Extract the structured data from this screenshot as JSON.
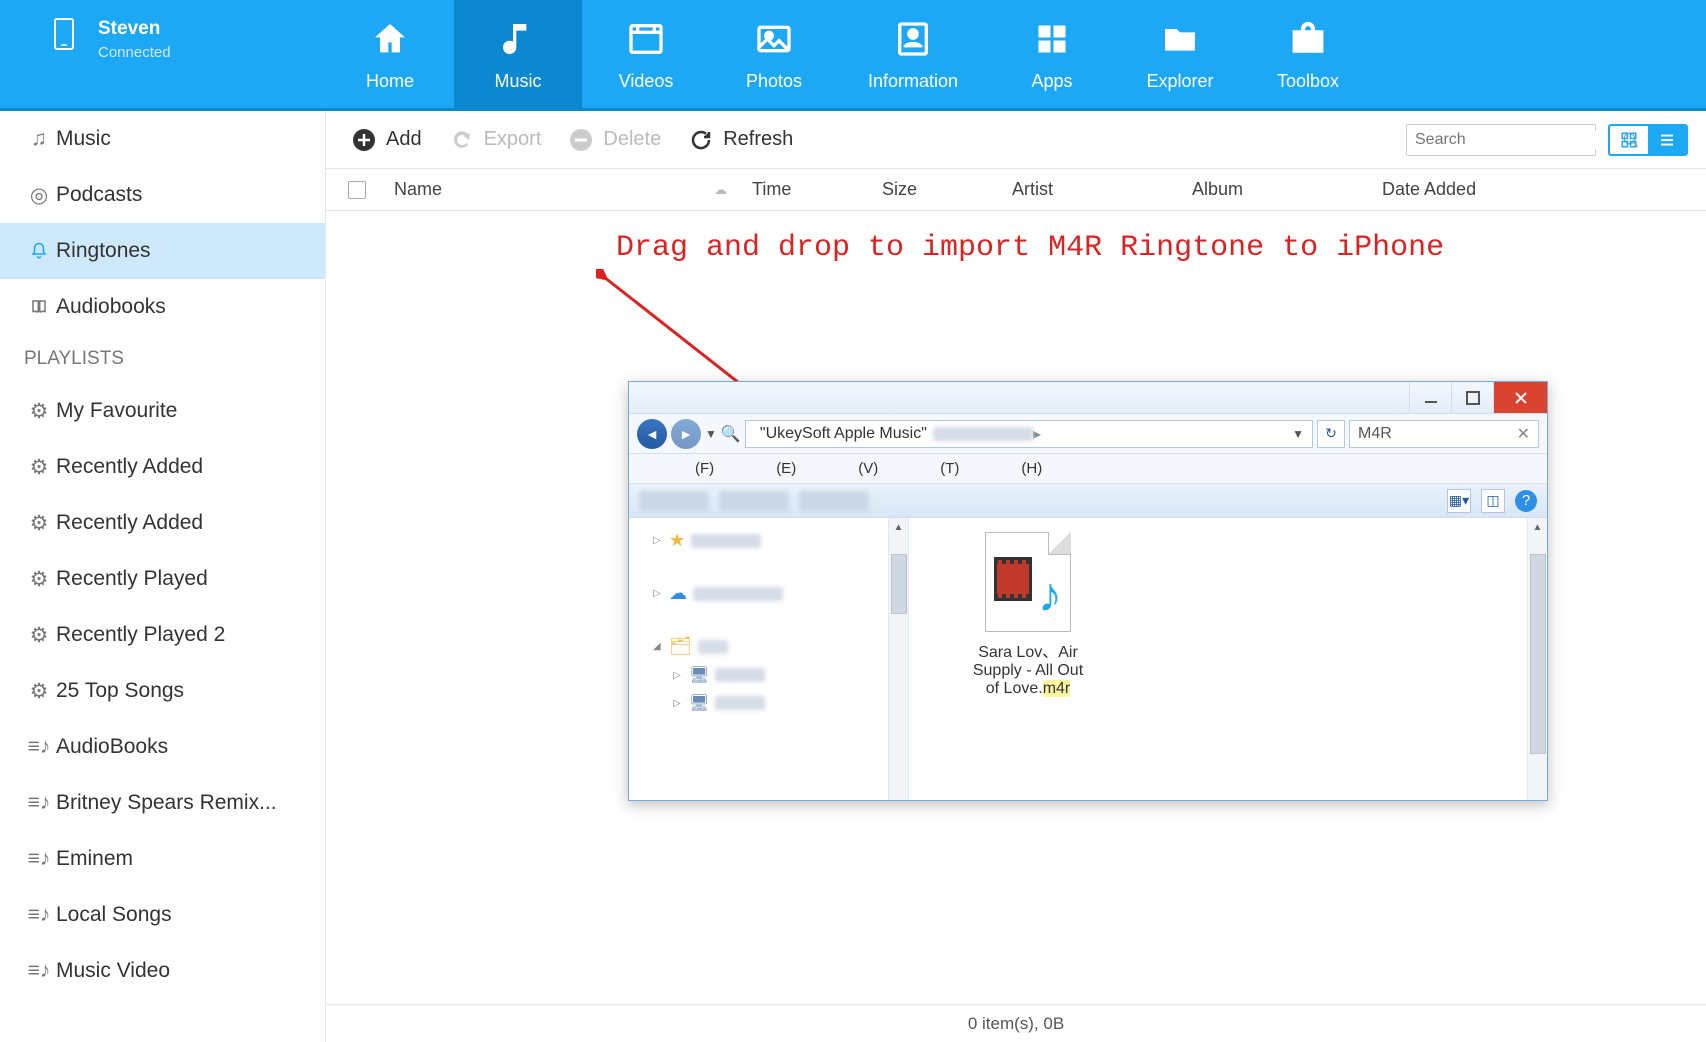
{
  "device": {
    "name": "Steven",
    "status": "Connected"
  },
  "nav": {
    "home": "Home",
    "music": "Music",
    "videos": "Videos",
    "photos": "Photos",
    "information": "Information",
    "apps": "Apps",
    "explorer": "Explorer",
    "toolbox": "Toolbox"
  },
  "sidebar": {
    "categories": {
      "music": "Music",
      "podcasts": "Podcasts",
      "ringtones": "Ringtones",
      "audiobooks": "Audiobooks"
    },
    "playlists_header": "PLAYLISTS",
    "playlists": [
      "My Favourite",
      "Recently Added",
      "Recently Added",
      "Recently Played",
      "Recently Played 2",
      "25 Top Songs",
      "AudioBooks",
      "Britney Spears Remix...",
      "Eminem",
      "Local Songs",
      "Music Video"
    ]
  },
  "toolbar": {
    "add": "Add",
    "export": "Export",
    "delete": "Delete",
    "refresh": "Refresh",
    "search_placeholder": "Search"
  },
  "columns": {
    "name": "Name",
    "time": "Time",
    "size": "Size",
    "artist": "Artist",
    "album": "Album",
    "date_added": "Date Added"
  },
  "instruction": "Drag and drop to import M4R Ringtone to iPhone",
  "explorer": {
    "path_label": "\"UkeySoft Apple Music\"",
    "search_value": "M4R",
    "menu_letters": [
      "(F)",
      "(E)",
      "(V)",
      "(T)",
      "(H)"
    ],
    "file_name_l1": "Sara Lov、Air",
    "file_name_l2": "Supply - All Out",
    "file_name_l3a": "of Love.",
    "file_name_l3b": "m4r"
  },
  "status": "0 item(s), 0B"
}
